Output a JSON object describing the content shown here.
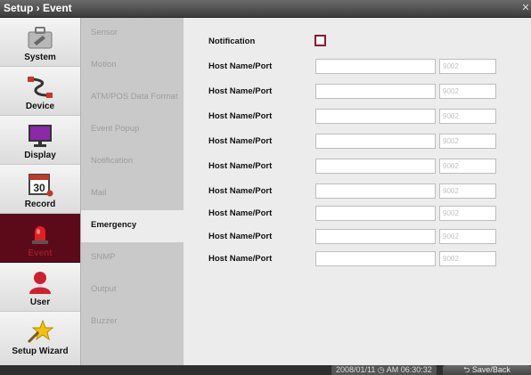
{
  "window": {
    "title": "Setup › Event",
    "close_glyph": "✕"
  },
  "sidebar": {
    "items": [
      {
        "label": "System",
        "icon": "toolbox-icon"
      },
      {
        "label": "Device",
        "icon": "cable-icon"
      },
      {
        "label": "Display",
        "icon": "monitor-icon"
      },
      {
        "label": "Record",
        "icon": "calendar-icon"
      },
      {
        "label": "Event",
        "icon": "siren-icon",
        "active": true
      },
      {
        "label": "User",
        "icon": "user-icon"
      },
      {
        "label": "Setup Wizard",
        "icon": "star-wand-icon"
      }
    ]
  },
  "submenu": {
    "items": [
      {
        "label": "Sensor"
      },
      {
        "label": "Motion"
      },
      {
        "label": "ATM/POS Data Format"
      },
      {
        "label": "Event Popup"
      },
      {
        "label": "Notification"
      },
      {
        "label": "Mail"
      },
      {
        "label": "Emergency",
        "active": true
      },
      {
        "label": "SNMP"
      },
      {
        "label": "Output"
      },
      {
        "label": "Buzzer"
      }
    ]
  },
  "content": {
    "notification_label": "Notification",
    "notification_checked": false,
    "hosts": [
      {
        "label": "Host Name/Port",
        "host_value": "",
        "port_placeholder": "9002"
      },
      {
        "label": "Host Name/Port",
        "host_value": "",
        "port_placeholder": "9002"
      },
      {
        "label": "Host Name/Port",
        "host_value": "",
        "port_placeholder": "9002"
      },
      {
        "label": "Host Name/Port",
        "host_value": "",
        "port_placeholder": "9002"
      },
      {
        "label": "Host Name/Port",
        "host_value": "",
        "port_placeholder": "9002"
      },
      {
        "label": "Host Name/Port",
        "host_value": "",
        "port_placeholder": "9002"
      },
      {
        "label": "Host Name/Port",
        "host_value": "",
        "port_placeholder": "9002"
      },
      {
        "label": "Host Name/Port",
        "host_value": "",
        "port_placeholder": "9002"
      },
      {
        "label": "Host Name/Port",
        "host_value": "",
        "port_placeholder": "9002"
      }
    ]
  },
  "footer": {
    "datetime": "2008/01/11 ◷ AM 06:30:32",
    "save_back_label": "⮌ Save/Back"
  },
  "colors": {
    "accent": "#8a1a2a",
    "active_side": "#5c0a1a"
  }
}
